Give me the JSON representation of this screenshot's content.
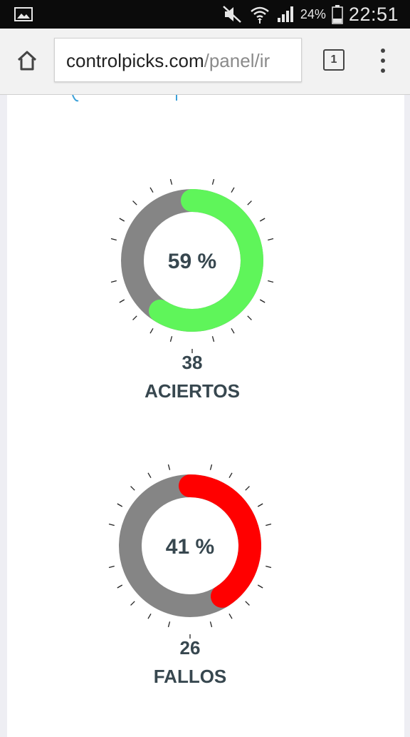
{
  "status_bar": {
    "battery_percent": "24%",
    "time": "22:51",
    "icons": [
      "gallery-notification-icon",
      "mute-icon",
      "wifi-icon",
      "signal-icon",
      "battery-icon"
    ]
  },
  "browser": {
    "url_domain": "controlpicks.com",
    "url_path": "/panel/ir",
    "tab_count": "1",
    "icons": [
      "home-icon",
      "tabs-icon",
      "overflow-menu-icon"
    ]
  },
  "stats": [
    {
      "percent_text": "59 %",
      "percent": 59,
      "count": "38",
      "label": "ACIERTOS",
      "color": "#5ff55a",
      "track_color": "#858585"
    },
    {
      "percent_text": "41 %",
      "percent": 41,
      "count": "26",
      "label": "FALLOS",
      "color": "#ff0000",
      "track_color": "#858585"
    }
  ]
}
